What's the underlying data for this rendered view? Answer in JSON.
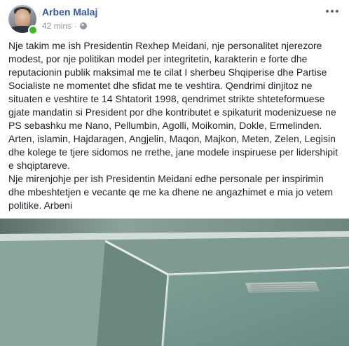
{
  "post": {
    "author": "Arben Malaj",
    "time": "42 mins",
    "separator": "·",
    "privacy_icon": "globe-icon",
    "options_icon": "more-options-icon",
    "paragraphs": [
      "Nje takim me ish Presidentin Rexhep Meidani, nje personalitet njerezore\nmodest, por nje politikan model per integritetin, karakterin e forte dhe\nreputacionin publik maksimal me te cilat I sherbeu Shqiperise dhe Partise\nSocialiste ne momentet dhe sfidat me te veshtira. Qendrimi dinjitoz ne\nsituaten e veshtire te 14 Shtatorit 1998, qendrimet strikte shteteformuese\ngjate mandatin si President por dhe kontributet e spikaturit modenizuese ne\nPS sebashku me Nano, Pellumbin, Agolli, Moikomin, Dokle, Ermelinden.\nArten, islamin, Hajdaragen, Angjelin, Maqon, Majkon, Meten, Zelen, Legisin\ndhe kolege te tjere sidomos ne rrethe, jane modele inspiruese per lidershipit\ne shqiptareve.",
      "Nje mirenjohje per ish Presidentin Meidani edhe personale per inspirimin\ndhe mbeshtetjen e vecante qe me ka dhene ne angazhimet e mia jo vetem\npolitike. Arbeni"
    ]
  },
  "colors": {
    "author_link": "#365899",
    "meta_text": "#90949c",
    "body_text": "#1d2129",
    "online": "#42b72a"
  }
}
